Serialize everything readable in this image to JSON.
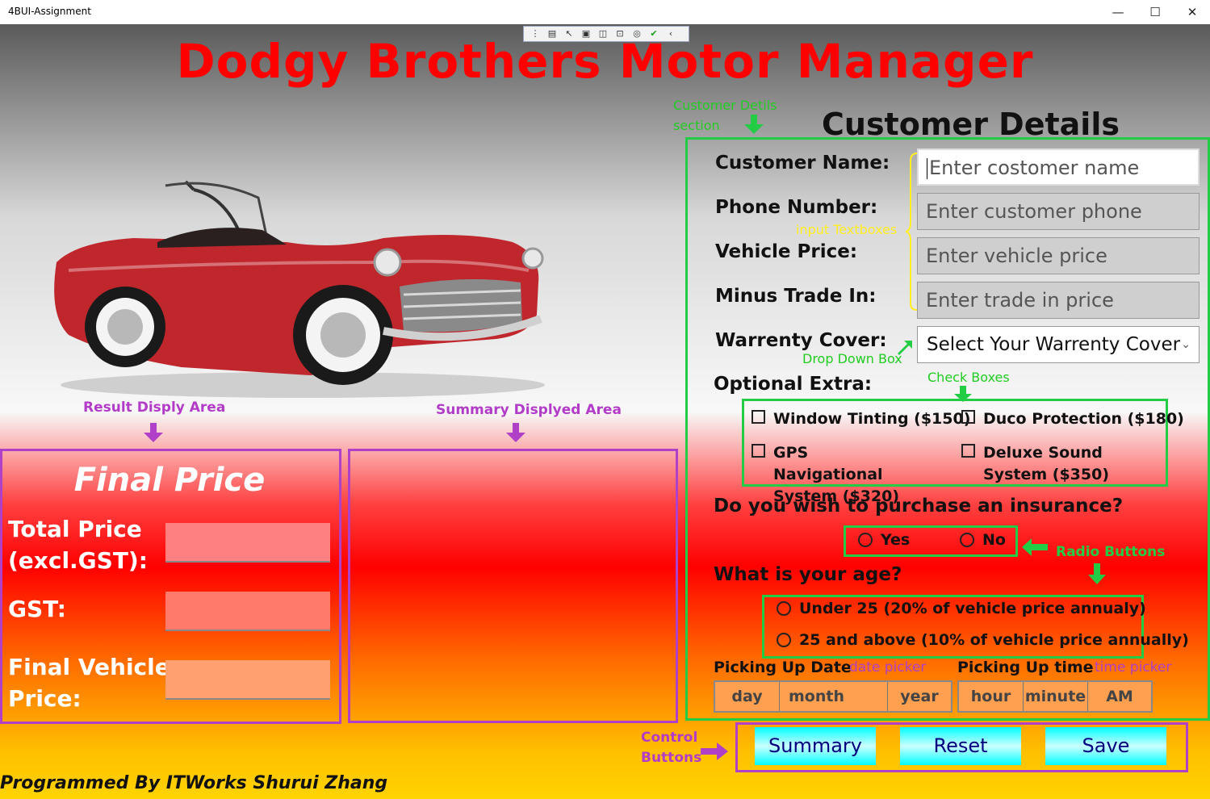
{
  "window": {
    "title": "4BUI-Assignment",
    "minimize": "—",
    "maximize": "☐",
    "close": "✕"
  },
  "app_title": "Dodgy Brothers Motor Manager",
  "annotations": {
    "customer_details_section": [
      "Customer Detils",
      "section"
    ],
    "input_textboxes": "input Textboxes",
    "drop_down_box": "Drop Down Box",
    "check_boxes": "Check Boxes",
    "radio_buttons": "Radio Buttons",
    "result_display_area": "Result Disply Area",
    "summary_display_area": "Summary Displyed Area",
    "date_picker": "date picker",
    "time_picker": "time picker",
    "control_buttons": [
      "Control",
      "Buttons"
    ]
  },
  "result": {
    "title": "Final Price",
    "total_label": [
      "Total Price",
      "(excl.GST):"
    ],
    "gst_label": "GST:",
    "final_label": [
      "Final Vehicle",
      "Price:"
    ]
  },
  "customer": {
    "title": "Customer Details",
    "name_label": "Customer Name:",
    "name_placeholder": "Enter costomer name",
    "phone_label": "Phone Number:",
    "phone_placeholder": "Enter customer phone",
    "price_label": "Vehicle Price:",
    "price_placeholder": "Enter vehicle price",
    "trade_label": "Minus Trade In:",
    "trade_placeholder": "Enter trade in price",
    "warranty_label": "Warrenty Cover:",
    "warranty_selected": "Select Your Warrenty Cover",
    "extras_label": "Optional Extra:",
    "extras": [
      {
        "label": "Window Tinting ($150)",
        "checked": false
      },
      {
        "label": "Duco Protection ($180)",
        "checked": false
      },
      {
        "label": "GPS Navigational System ($320)",
        "checked": false
      },
      {
        "label": "Deluxe Sound System ($350)",
        "checked": false
      }
    ],
    "insurance_question": "Do you wish to purchase an insurance?",
    "insurance_options": [
      "Yes",
      "No"
    ],
    "age_question": "What is your age?",
    "age_options": [
      "Under 25 (20% of vehicle price annualy)",
      "25 and above (10% of vehicle price annually)"
    ],
    "pickup_date_label": "Picking Up Date",
    "date_parts": [
      "day",
      "month",
      "year"
    ],
    "pickup_time_label": "Picking Up time",
    "time_parts": [
      "hour",
      "minute",
      "AM"
    ]
  },
  "buttons": {
    "summary": "Summary",
    "reset": "Reset",
    "save": "Save"
  },
  "footer": "Programmed By ITWorks Shurui Zhang",
  "colors": {
    "title_red": "#ff0000",
    "annotation_purple": "#b040c8",
    "annotation_green": "#22cc44",
    "button_cyan": "#00ffff"
  }
}
